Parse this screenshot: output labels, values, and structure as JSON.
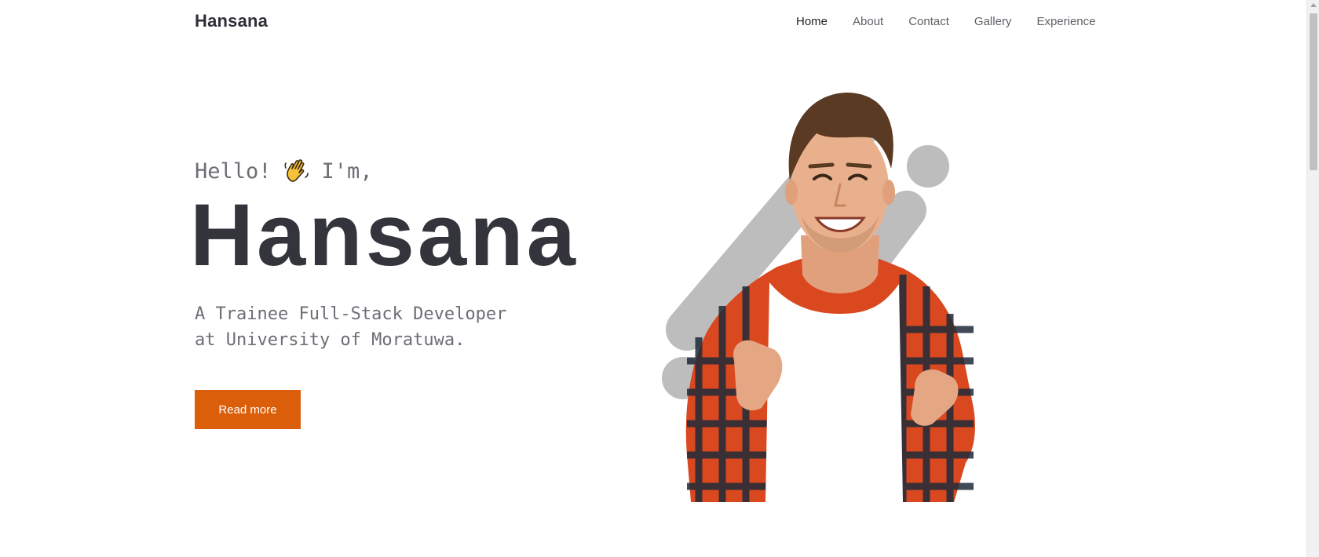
{
  "header": {
    "brand": "Hansana",
    "nav": [
      {
        "label": "Home",
        "active": true
      },
      {
        "label": "About",
        "active": false
      },
      {
        "label": "Contact",
        "active": false
      },
      {
        "label": "Gallery",
        "active": false
      },
      {
        "label": "Experience",
        "active": false
      }
    ]
  },
  "hero": {
    "greeting_before": "Hello!",
    "greeting_icon": "waving-hand-icon",
    "greeting_after": "I'm,",
    "name": "Hansana",
    "tagline_line1": "A Trainee Full-Stack Developer",
    "tagline_line2": "at University of Moratuwa.",
    "cta_label": "Read more",
    "portrait": "smiling-man-plaid-shirt-photo"
  },
  "colors": {
    "accent": "#db5f0a",
    "heading": "#33343c",
    "muted": "#6d6e75",
    "decor_gray": "#bdbdbd"
  }
}
